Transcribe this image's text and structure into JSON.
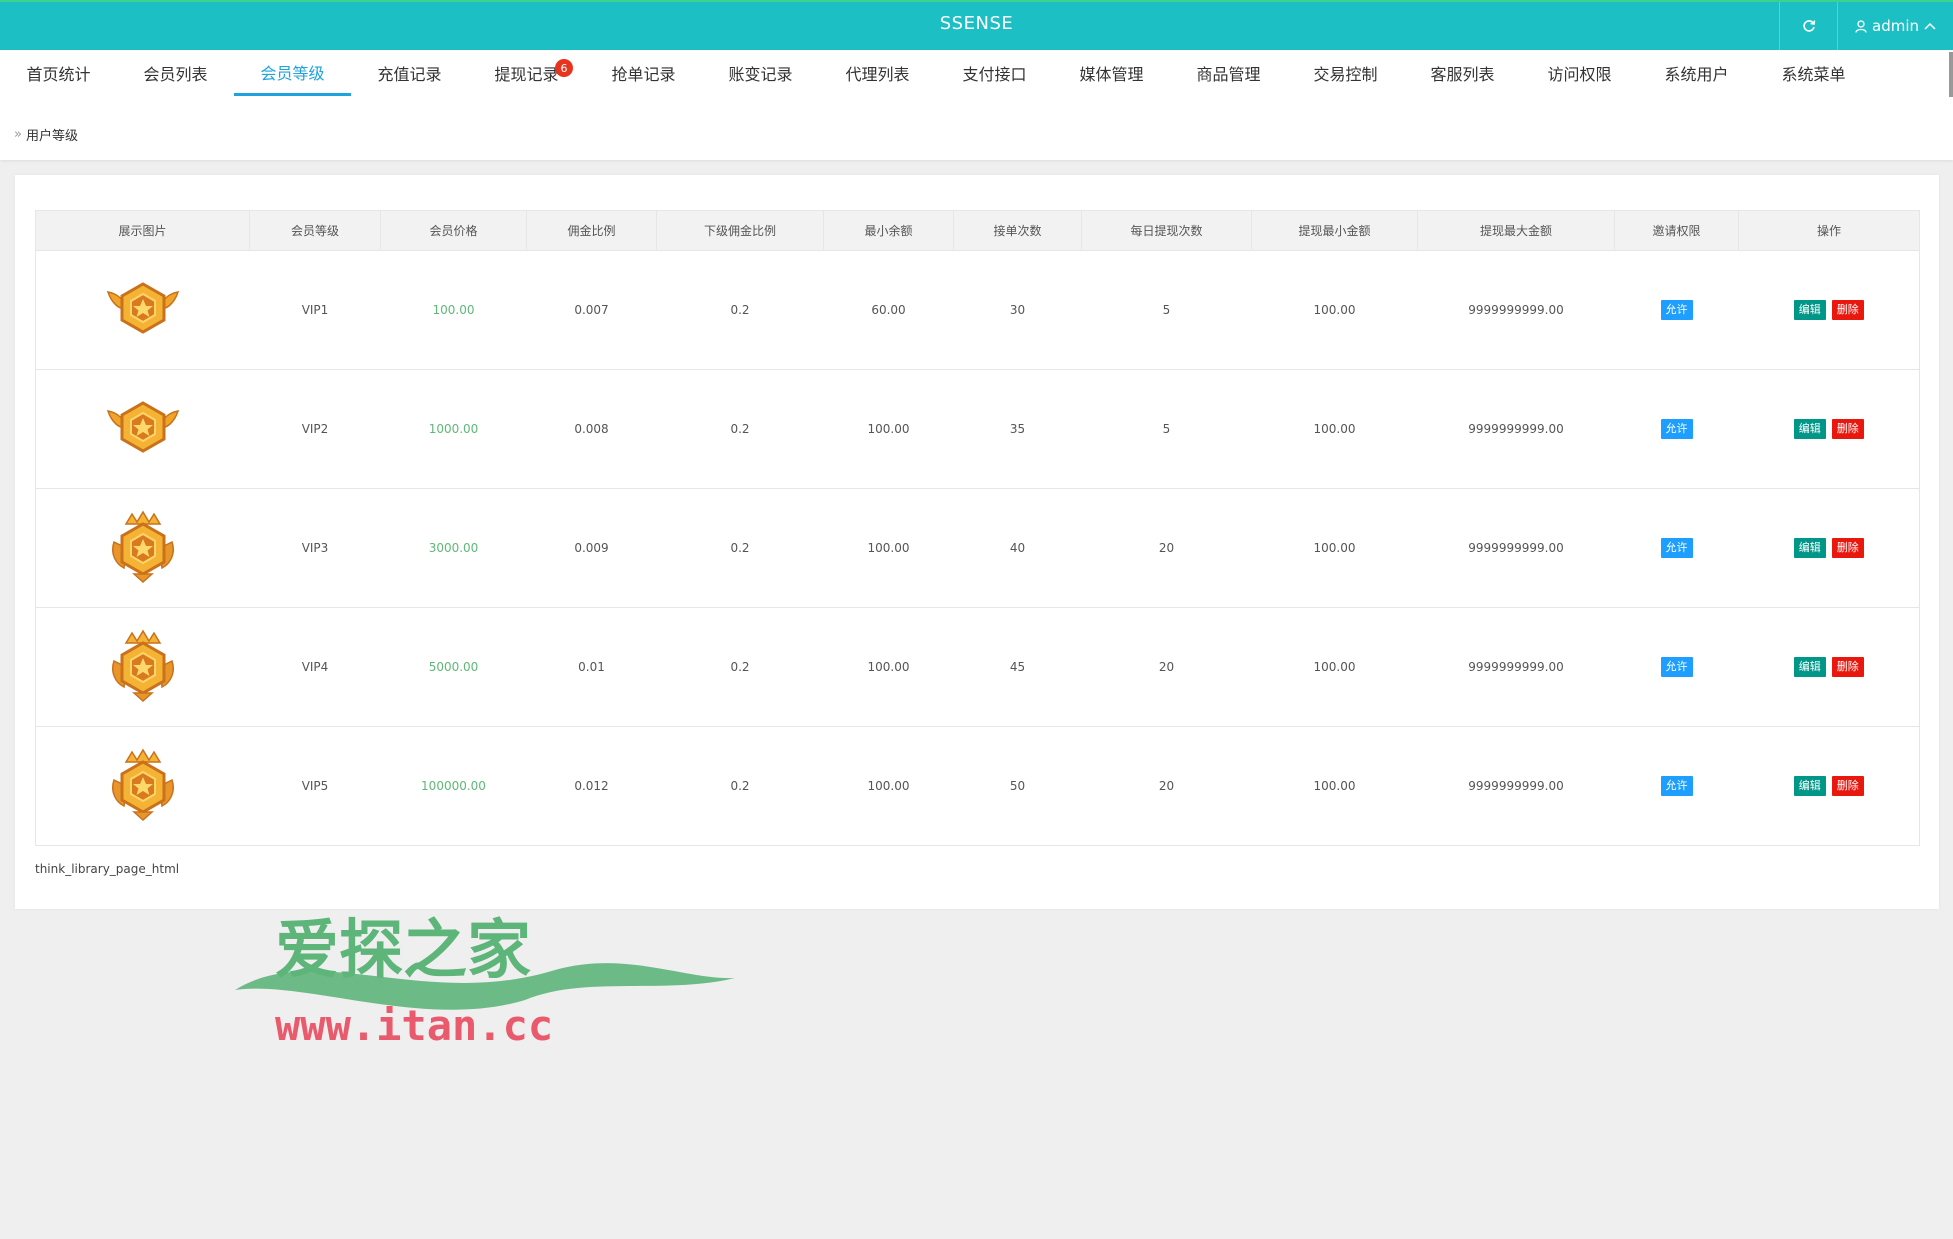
{
  "header": {
    "brand": "SSENSE",
    "user_label": "admin"
  },
  "nav": {
    "items": [
      {
        "label": "首页统计"
      },
      {
        "label": "会员列表"
      },
      {
        "label": "会员等级"
      },
      {
        "label": "充值记录"
      },
      {
        "label": "提现记录",
        "badge": "6"
      },
      {
        "label": "抢单记录"
      },
      {
        "label": "账变记录"
      },
      {
        "label": "代理列表"
      },
      {
        "label": "支付接口"
      },
      {
        "label": "媒体管理"
      },
      {
        "label": "商品管理"
      },
      {
        "label": "交易控制"
      },
      {
        "label": "客服列表"
      },
      {
        "label": "访问权限"
      },
      {
        "label": "系统用户"
      },
      {
        "label": "系统菜单"
      }
    ],
    "active_index": 2
  },
  "breadcrumb": {
    "current": "用户等级"
  },
  "table": {
    "headers": [
      "展示图片",
      "会员等级",
      "会员价格",
      "佣金比例",
      "下级佣金比例",
      "最小余额",
      "接单次数",
      "每日提现次数",
      "提现最小金额",
      "提现最大金额",
      "邀请权限",
      "操作"
    ],
    "rows": [
      {
        "level": "VIP1",
        "price": "100.00",
        "commission": "0.007",
        "sub_commission": "0.2",
        "min_balance": "60.00",
        "orders": "30",
        "daily_withdraw": "5",
        "withdraw_min": "100.00",
        "withdraw_max": "9999999999.00",
        "invite": "允许",
        "badge_style": "wings"
      },
      {
        "level": "VIP2",
        "price": "1000.00",
        "commission": "0.008",
        "sub_commission": "0.2",
        "min_balance": "100.00",
        "orders": "35",
        "daily_withdraw": "5",
        "withdraw_min": "100.00",
        "withdraw_max": "9999999999.00",
        "invite": "允许",
        "badge_style": "wings"
      },
      {
        "level": "VIP3",
        "price": "3000.00",
        "commission": "0.009",
        "sub_commission": "0.2",
        "min_balance": "100.00",
        "orders": "40",
        "daily_withdraw": "20",
        "withdraw_min": "100.00",
        "withdraw_max": "9999999999.00",
        "invite": "允许",
        "badge_style": "crown"
      },
      {
        "level": "VIP4",
        "price": "5000.00",
        "commission": "0.01",
        "sub_commission": "0.2",
        "min_balance": "100.00",
        "orders": "45",
        "daily_withdraw": "20",
        "withdraw_min": "100.00",
        "withdraw_max": "9999999999.00",
        "invite": "允许",
        "badge_style": "crown"
      },
      {
        "level": "VIP5",
        "price": "100000.00",
        "commission": "0.012",
        "sub_commission": "0.2",
        "min_balance": "100.00",
        "orders": "50",
        "daily_withdraw": "20",
        "withdraw_min": "100.00",
        "withdraw_max": "9999999999.00",
        "invite": "允许",
        "badge_style": "crown"
      }
    ],
    "actions": {
      "edit": "编辑",
      "delete": "删除"
    }
  },
  "pager": {
    "text": "think_library_page_html"
  },
  "watermark": {
    "title": "爱探之家",
    "url": "www.itan.cc"
  },
  "colors": {
    "topbar": "#1cc0c4",
    "active_tab": "#1ea3df",
    "price": "#5fb878",
    "allow": "#1e9fff",
    "edit": "#009688",
    "delete": "#e8180f"
  }
}
